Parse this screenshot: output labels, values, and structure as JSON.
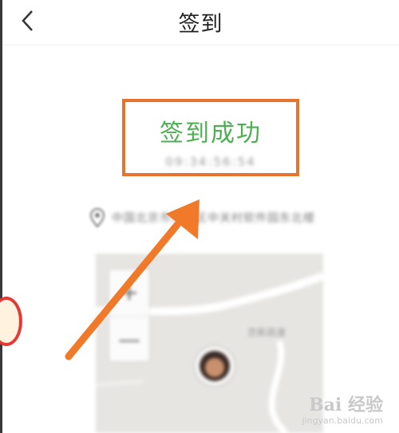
{
  "header": {
    "title": "签到",
    "back_icon": "chevron-left-icon"
  },
  "checkin": {
    "status": "签到成功",
    "time": "09:34:56:54"
  },
  "location": {
    "icon": "location-pin-icon",
    "address": "中国北京市海淀区中关村软件园东北楼"
  },
  "map": {
    "zoom_in_label": "+",
    "zoom_out_label": "—",
    "label": "京新高速"
  },
  "watermark": {
    "brand": "Bai 经验",
    "url": "jingyan.baidu.com"
  },
  "colors": {
    "success": "#4caf50",
    "highlight": "#e8732e"
  }
}
